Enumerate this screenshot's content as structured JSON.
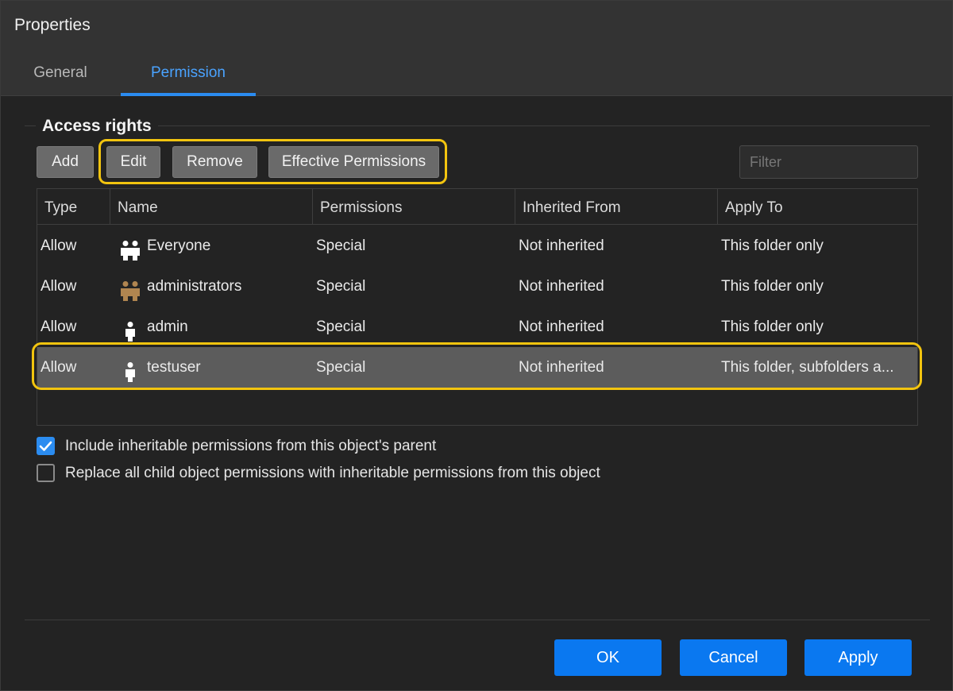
{
  "window": {
    "title": "Properties"
  },
  "tabs": [
    {
      "label": "General",
      "active": false
    },
    {
      "label": "Permission",
      "active": true
    }
  ],
  "access_rights": {
    "title": "Access rights",
    "buttons": {
      "add": "Add",
      "edit": "Edit",
      "remove": "Remove",
      "effective": "Effective Permissions"
    },
    "filter_placeholder": "Filter",
    "columns": [
      "Type",
      "Name",
      "Permissions",
      "Inherited From",
      "Apply To"
    ],
    "rows": [
      {
        "type": "Allow",
        "icon": "group-icon",
        "name": "Everyone",
        "permissions": "Special",
        "inherited_from": "Not inherited",
        "apply_to": "This folder only"
      },
      {
        "type": "Allow",
        "icon": "admin-group-icon",
        "name": "administrators",
        "permissions": "Special",
        "inherited_from": "Not inherited",
        "apply_to": "This folder only"
      },
      {
        "type": "Allow",
        "icon": "user-icon",
        "name": "admin",
        "permissions": "Special",
        "inherited_from": "Not inherited",
        "apply_to": "This folder only"
      },
      {
        "type": "Allow",
        "icon": "user-icon",
        "name": "testuser",
        "permissions": "Special",
        "inherited_from": "Not inherited",
        "apply_to": "This folder, subfolders a...",
        "selected": true
      }
    ]
  },
  "options": {
    "include_inheritable": {
      "label": "Include inheritable permissions from this object's parent",
      "checked": true
    },
    "replace_child": {
      "label": "Replace all child object permissions with inheritable permissions from this object",
      "checked": false
    }
  },
  "footer": {
    "ok": "OK",
    "cancel": "Cancel",
    "apply": "Apply"
  },
  "colors": {
    "accent": "#2b8cf0",
    "highlight": "#f2c40f",
    "admin_icon": "#b08550"
  }
}
